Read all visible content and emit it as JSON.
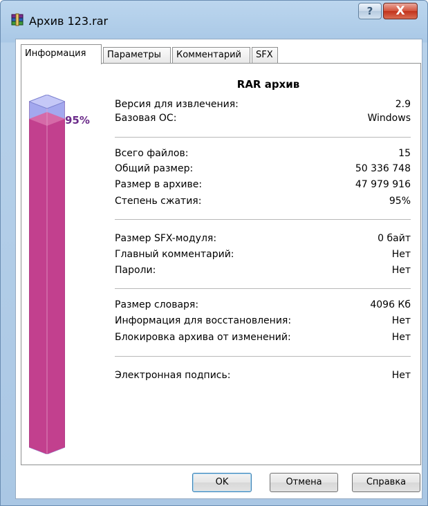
{
  "window": {
    "title": "Архив 123.rar",
    "help_glyph": "?",
    "close_glyph": "X"
  },
  "tabs": [
    "Информация",
    "Параметры",
    "Комментарий",
    "SFX"
  ],
  "info": {
    "heading": "RAR архив",
    "compression_percent": 95,
    "compression_label": "95%",
    "groups": [
      [
        {
          "label": "Версия для извлечения:",
          "value": "2.9"
        },
        {
          "label": "Базовая ОС:",
          "value": "Windows"
        }
      ],
      [
        {
          "label": "Всего файлов:",
          "value": "15"
        },
        {
          "label": "Общий размер:",
          "value": "50 336 748"
        },
        {
          "label": "Размер в архиве:",
          "value": "47 979 916"
        },
        {
          "label": "Степень сжатия:",
          "value": "95%"
        }
      ],
      [
        {
          "label": "Размер SFX-модуля:",
          "value": "0 байт"
        },
        {
          "label": "Главный комментарий:",
          "value": "Нет"
        },
        {
          "label": "Пароли:",
          "value": "Нет"
        }
      ],
      [
        {
          "label": "Размер словаря:",
          "value": "4096 Кб"
        },
        {
          "label": "Информация для восстановления:",
          "value": "Нет"
        },
        {
          "label": "Блокировка архива от изменений:",
          "value": "Нет"
        }
      ],
      [
        {
          "label": "Электронная подпись:",
          "value": "Нет"
        }
      ]
    ]
  },
  "buttons": {
    "ok": "OK",
    "cancel": "Отмена",
    "help": "Справка"
  },
  "colors": {
    "bar_fill": "#c2408e",
    "bar_empty": "#a3a8ee"
  }
}
